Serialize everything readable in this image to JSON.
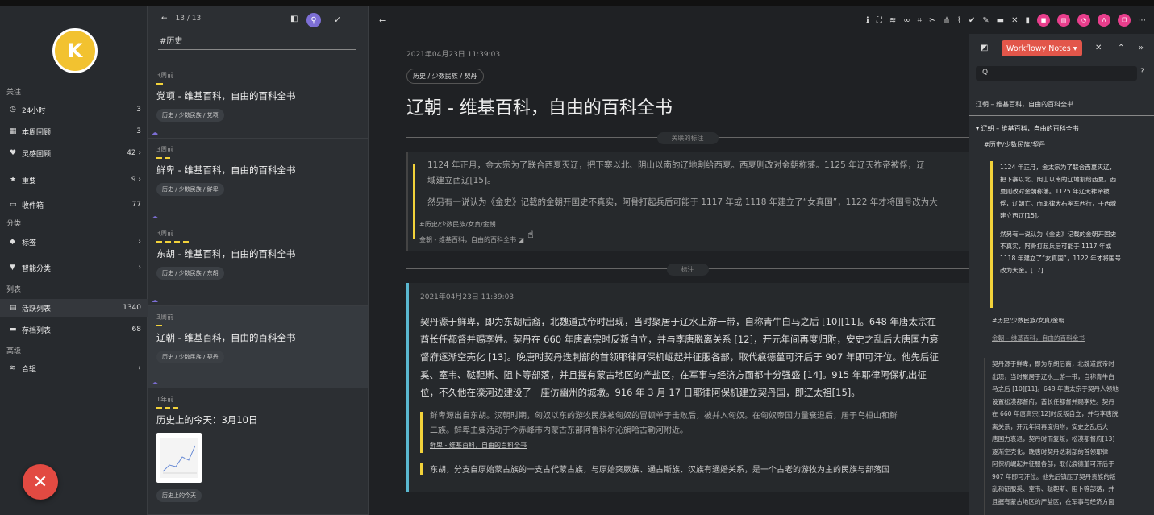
{
  "colors": {
    "accent": "#f2d23a",
    "brand": "#7d6fd6",
    "danger": "#e24a42",
    "note_border": "#5ab8d0"
  },
  "sidebar": {
    "avatar_initial": "K",
    "sections": {
      "follow": "关注",
      "category": "分类",
      "list": "列表",
      "advanced": "高级"
    },
    "items": [
      {
        "icon": "clock-icon",
        "label": "24小时",
        "count": "3"
      },
      {
        "icon": "calendar-icon",
        "label": "本周回顾",
        "count": "3"
      },
      {
        "icon": "bulb-icon",
        "label": "灵感回顾",
        "count": "42 ›"
      },
      {
        "icon": "star-icon",
        "label": "重要",
        "count": "9 ›"
      },
      {
        "icon": "inbox-icon",
        "label": "收件箱",
        "count": "77"
      },
      {
        "icon": "tag-icon",
        "label": "标签",
        "count": "›"
      },
      {
        "icon": "filter-icon",
        "label": "智能分类",
        "count": "›"
      },
      {
        "icon": "list-icon",
        "label": "活跃列表",
        "count": "1340"
      },
      {
        "icon": "archive-icon",
        "label": "存档列表",
        "count": "68"
      },
      {
        "icon": "layers-icon",
        "label": "合辑",
        "count": "›"
      }
    ],
    "fab": "✕"
  },
  "list": {
    "counter": "13 / 13",
    "query": "#历史",
    "cards": [
      {
        "time": "3周前",
        "title": "党项 - 维基百科，自由的百科全书",
        "tag": "历史 / 少数民族 / 党项"
      },
      {
        "time": "3周前",
        "title": "鲜卑 - 维基百科，自由的百科全书",
        "tag": "历史 / 少数民族 / 鲜卑"
      },
      {
        "time": "3周前",
        "title": "东胡 - 维基百科，自由的百科全书",
        "tag": "历史 / 少数民族 / 东胡"
      },
      {
        "time": "3周前",
        "title": "辽朝 - 维基百科，自由的百科全书",
        "tag": "历史 / 少数民族 / 契丹"
      },
      {
        "time": "1年前",
        "title": "历史上的今天：3月10日",
        "tag": "历史上的今天"
      }
    ]
  },
  "main": {
    "date": "2021年04月23日 11:39:03",
    "path": "历史 / 少数民族 / 契丹",
    "title": "辽朝 - 维基百科，自由的百科全书",
    "related_label": "关联的标注",
    "quote_p1": "1124 年正月，金太宗为了联合西夏灭辽，把下寨以北、阴山以南的辽地割给西夏。西夏则改对金朝称藩。1125 年辽天祚帝被俘，辽",
    "quote_p2": "域建立西辽[15]。",
    "quote_p3": "然另有一说认为《金史》记载的金朝开国史不真实，阿骨打起兵后可能于 1117 年或 1118 年建立了“女真国”，1122 年才将国号改为大",
    "quote_tag": "#历史/少数民族/女真/金朝",
    "quote_link": "金朝 - 维基百科，自由的百科全书",
    "notes_label": "标注",
    "note_date": "2021年04月23日 11:39:03",
    "note_lines": [
      "契丹源于鲜卑，即为东胡后裔，北魏道武帝时出现，当时聚居于辽水上游一带，自称青牛白马之后 [10][11]。648 年唐太宗在",
      "酋长任都督并赐李姓。契丹在 660 年唐高宗时反叛自立，并与李唐脱离关系 [12]，开元年间再度归附，安史之乱后大唐国力衰",
      "督府逐渐空壳化 [13]。晚唐时契丹迭刺部的首领耶律阿保机崛起并征服各部，取代痕德堇可汗后于 907 年即可汗位。他先后征",
      "奚、室韦、鞑靼斯、阻卜等部落，并且握有蒙古地区的产盐区，在军事与经济方面都十分强盛 [14]。915 年耶律阿保机出征",
      "位，不久他在滦河边建设了一座仿幽州的城墩。916 年 3 月 17 日耶律阿保机建立契丹国，即辽太祖[15]。"
    ],
    "sub_lines": [
      "鲜卑源出自东胡。汉朝时期，匈奴以东的游牧民族被匈奴的冒顿单于击败后，被并入匈奴。在匈奴帝国力量衰退后，居于乌桓山和鲜",
      "二族。鲜卑主要活动于今赤峰市内蒙古东部阿鲁科尔沁旗哈古勒河附近。"
    ],
    "sub_link": "鲜卑 - 维基百科，自由的百科全书",
    "sub2": "东胡，分支自原始蒙古族的一支古代蒙古族，与原始突厥族、通古斯族、汉族有通婚关系，是一个古老的游牧为主的民族与部落国"
  },
  "right_panel": {
    "button": "Workflowy Notes ▾",
    "search_icon": "Q",
    "help": "?",
    "title": "辽朝 – 维基百科，自由的百科全书",
    "bullet": "▾ 辽朝 – 维基百科，自由的百科全书",
    "tag": "#历史/少数民族/契丹",
    "quote_lines": [
      "1124 年正月，金太宗为了联合西夏灭辽，",
      "把下寨以北、阴山以南的辽地割给西夏。西",
      "夏则改对金朝称藩。1125 年辽天祚帝被",
      "俘，辽朝亡。而耶律大石率军西行，于西域",
      "建立西辽[15]。",
      "",
      "然另有一说认为《金史》记载的金朝开国史",
      "不真实，阿骨打起兵后可能于 1117 年或",
      "1118 年建立了“女真国”，1122 年才将国号",
      "改为大金。[17]"
    ],
    "tag2": "#历史/少数民族/女真/金朝",
    "link2": "金朝 – 维基百科，自由的百科全书",
    "body_lines": [
      "契丹源于鲜卑，即为东胡后裔，北魏道武帝时",
      "出现，当时聚居于辽水上游一带，自称青牛白",
      "马之后 [10][11]。648 年唐太宗于契丹人领地",
      "设置松漠都督府，酋长任都督并赐李姓。契丹",
      "在 660 年唐高宗[12]时反叛自立，并与李唐脱",
      "离关系，开元年间再度归附，安史之乱后大",
      "唐国力衰退，契丹时而复叛，松漠都督府[13]",
      "逐渐空壳化，晚唐时契丹迭刺部的首领耶律",
      "阿保机崛起并征服各部，取代痕德堇可汗后于",
      "907 年即可汗位。他先后镇压了契丹贵族的叛",
      "乱和征服奚、室韦、鞑靼斯、阻卜等部落，并",
      "且握有蒙古地区的产盐区，在军事与经济方面"
    ]
  }
}
